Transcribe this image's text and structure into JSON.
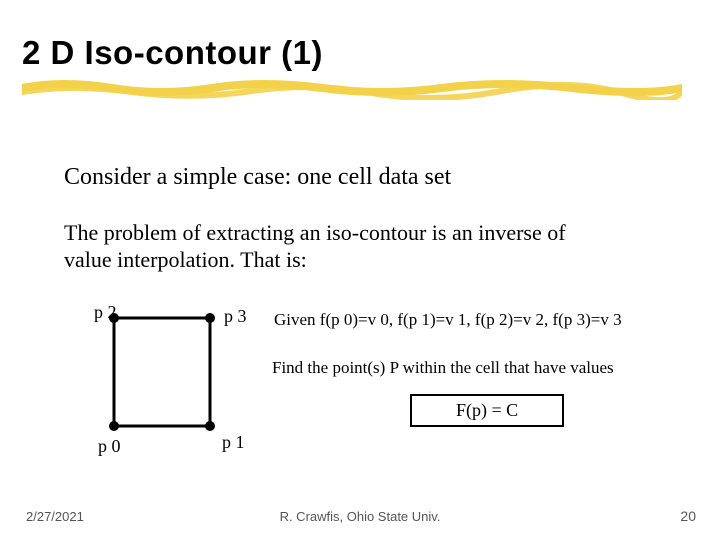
{
  "title": "2 D Iso-contour (1)",
  "body1": "Consider a simple case: one cell data set",
  "body2": "The problem of extracting an iso-contour is an inverse of value interpolation. That is:",
  "labels": {
    "p0": "p 0",
    "p1": "p 1",
    "p2": "p 2",
    "p3": "p 3"
  },
  "given": "Given f(p 0)=v 0, f(p 1)=v 1, f(p 2)=v 2, f(p 3)=v 3",
  "find": "Find  the point(s) P within the cell that have values",
  "equation": "F(p) = C",
  "footer": {
    "date": "2/27/2021",
    "attrib": "R. Crawfis, Ohio State Univ.",
    "page": "20"
  },
  "colors": {
    "highlight": "#f3d24a",
    "eqbox_border": "#000000"
  }
}
